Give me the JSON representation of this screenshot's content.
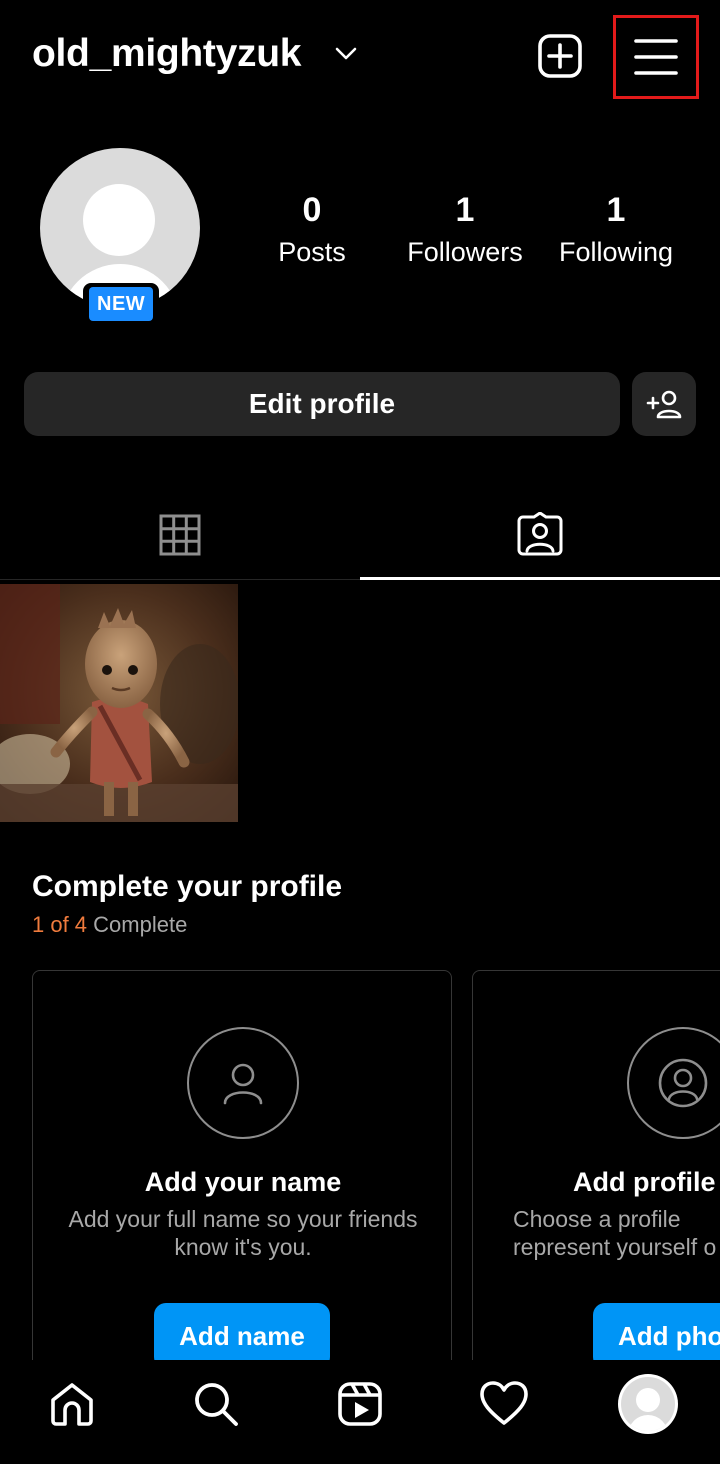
{
  "header": {
    "username": "old_mightyzuk",
    "icons": {
      "account_switch": "chevron-down-icon",
      "create": "plus-square-icon",
      "menu": "hamburger-menu-icon"
    }
  },
  "profile": {
    "badge": "NEW",
    "stats": [
      {
        "value": "0",
        "label": "Posts"
      },
      {
        "value": "1",
        "label": "Followers"
      },
      {
        "value": "1",
        "label": "Following"
      }
    ]
  },
  "actions": {
    "edit_profile": "Edit profile",
    "discover_icon": "add-person-icon"
  },
  "tabs": [
    {
      "icon": "grid-icon",
      "selected": false
    },
    {
      "icon": "tagged-person-icon",
      "selected": true
    }
  ],
  "complete_profile": {
    "title": "Complete your profile",
    "count": "1 of 4",
    "count_suffix": " Complete",
    "cards": [
      {
        "icon": "person-outline-icon",
        "title": "Add your name",
        "description": "Add your full name so your friends know it's you.",
        "button": "Add name"
      },
      {
        "icon": "profile-photo-icon",
        "title": "Add profile p",
        "description_lines": [
          "Choose a profile",
          "represent yourself o"
        ],
        "button": "Add pho"
      }
    ]
  },
  "bottom_nav": [
    "home-icon",
    "search-icon",
    "reels-icon",
    "heart-icon",
    "profile-avatar-icon"
  ],
  "colors": {
    "accent_blue": "#0095f6",
    "badge_blue": "#1a8cff",
    "progress_orange": "#f07b3d",
    "button_gray": "#262626",
    "highlight_red": "#e21a1a"
  }
}
